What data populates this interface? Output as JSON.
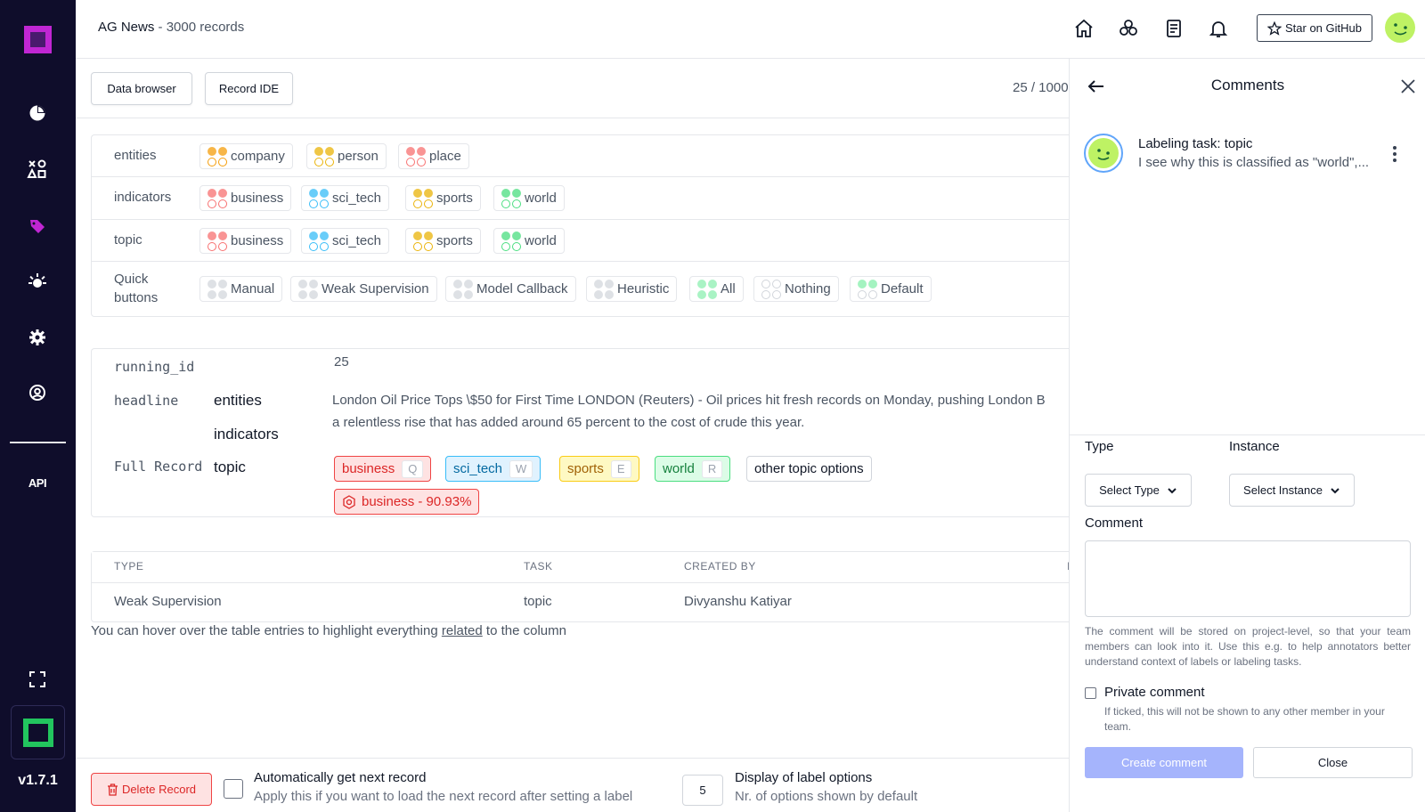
{
  "app": {
    "version": "v1.7.1",
    "api_label": "API"
  },
  "header": {
    "title": "AG News",
    "subtitle": " - 3000 records",
    "github_label": "Star on GitHub",
    "icons": [
      "home-icon",
      "modules-icon",
      "document-icon",
      "bell-icon"
    ]
  },
  "sidebar": {
    "items": [
      "overview-icon",
      "data-icon",
      "labeling-icon",
      "heuristics-icon",
      "settings-icon",
      "user-icon"
    ]
  },
  "toolbar": {
    "data_browser": "Data browser",
    "record_ide": "Record IDE",
    "record_count": "25 / 1000"
  },
  "labeling": {
    "rows": [
      {
        "name": "entities",
        "chips": [
          {
            "label": "company",
            "color": "#f59e0b"
          },
          {
            "label": "person",
            "color": "#eab308"
          },
          {
            "label": "place",
            "color": "#f87171"
          }
        ]
      },
      {
        "name": "indicators",
        "chips": [
          {
            "label": "business",
            "color": "#f87171"
          },
          {
            "label": "sci_tech",
            "color": "#38bdf8"
          },
          {
            "label": "sports",
            "color": "#eab308"
          },
          {
            "label": "world",
            "color": "#4ade80"
          }
        ]
      },
      {
        "name": "topic",
        "chips": [
          {
            "label": "business",
            "color": "#f87171"
          },
          {
            "label": "sci_tech",
            "color": "#38bdf8"
          },
          {
            "label": "sports",
            "color": "#eab308"
          },
          {
            "label": "world",
            "color": "#4ade80"
          }
        ]
      }
    ],
    "quick_label_1": "Quick",
    "quick_label_2": "buttons",
    "quick_buttons": [
      {
        "label": "Manual",
        "style": "grey"
      },
      {
        "label": "Weak Supervision",
        "style": "grey"
      },
      {
        "label": "Model Callback",
        "style": "grey"
      },
      {
        "label": "Heuristic",
        "style": "grey"
      },
      {
        "label": "All",
        "style": "green"
      },
      {
        "label": "Nothing",
        "style": "hollow"
      },
      {
        "label": "Default",
        "style": "mixed"
      }
    ]
  },
  "record": {
    "running_id_key": "running_id",
    "running_id_value": "25",
    "headline_key": "headline",
    "full_record_key": "Full Record",
    "task_entities": "entities",
    "task_indicators": "indicators",
    "task_topic": "topic",
    "headline_line1": "London Oil Price Tops \\$50 for First Time LONDON (Reuters) - Oil prices hit fresh records on Monday, pushing London B",
    "headline_line2": "a relentless rise that has added around 65 percent to the cost of crude this year.",
    "topic_options": [
      {
        "label": "business",
        "key": "Q",
        "border": "#ef4444",
        "bg": "#fee2e2",
        "color": "#dc2626"
      },
      {
        "label": "sci_tech",
        "key": "W",
        "border": "#38bdf8",
        "bg": "#e0f2fe",
        "color": "#0369a1"
      },
      {
        "label": "sports",
        "key": "E",
        "border": "#facc15",
        "bg": "#fef9c3",
        "color": "#a16207"
      },
      {
        "label": "world",
        "key": "R",
        "border": "#4ade80",
        "bg": "#dcfce7",
        "color": "#15803d"
      }
    ],
    "other_options": "other topic options",
    "prediction": "business - 90.93%"
  },
  "table": {
    "headers": [
      "TYPE",
      "TASK",
      "CREATED BY",
      "I"
    ],
    "row": {
      "type": "Weak Supervision",
      "task": "topic",
      "created_by": "Divyanshu Katiyar"
    },
    "hint_before": "You can hover over the table entries to highlight everything ",
    "hint_link": "related",
    "hint_after": " to the column"
  },
  "footer": {
    "delete_label": "Delete Record",
    "auto_title": "Automatically get next record",
    "auto_sub": "Apply this if you want to load the next record after setting a label",
    "display_value": "5",
    "display_title": "Display of label options",
    "display_sub": "Nr. of options shown by default"
  },
  "comments": {
    "title": "Comments",
    "entry_title": "Labeling task: topic",
    "entry_text": "I see why this is classified as \"world\",...",
    "type_label": "Type",
    "type_select": "Select Type",
    "instance_label": "Instance",
    "instance_select": "Select Instance",
    "comment_label": "Comment",
    "note": "The comment will be stored on project-level, so that your team members can look into it. Use this e.g. to help annotators better understand context of labels or labeling tasks.",
    "private_label": "Private comment",
    "private_sub": "If ticked, this will not be shown to any other member in your team.",
    "create_label": "Create comment",
    "close_label": "Close"
  }
}
